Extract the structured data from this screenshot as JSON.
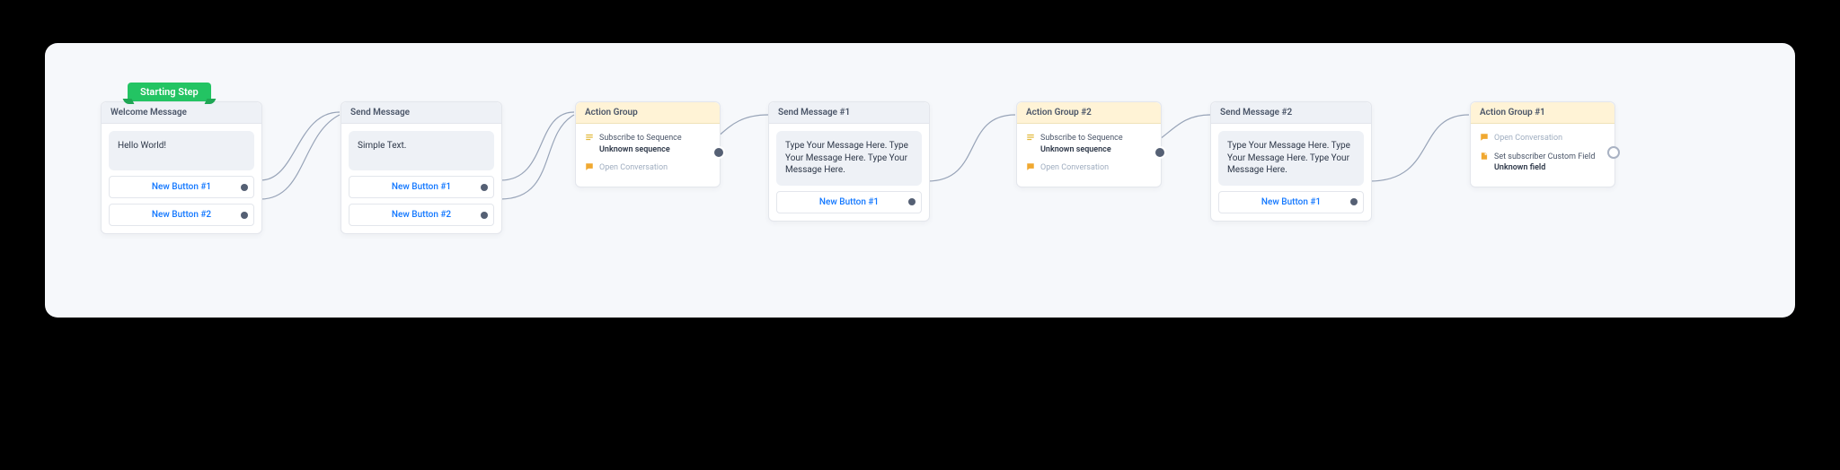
{
  "starting_step_label": "Starting Step",
  "nodes": {
    "welcome": {
      "title": "Welcome Message",
      "bubble": "Hello World!",
      "buttons": [
        "New Button #1",
        "New Button #2"
      ]
    },
    "send1": {
      "title": "Send Message",
      "bubble": "Simple Text.",
      "buttons": [
        "New Button #1",
        "New Button #2"
      ]
    },
    "ag1": {
      "title": "Action Group",
      "actions": [
        {
          "icon": "seq",
          "label": "Subscribe to Sequence",
          "sub": "Unknown sequence"
        },
        {
          "icon": "open",
          "label": "Open Conversation",
          "muted": true
        }
      ]
    },
    "sendmsg1": {
      "title": "Send Message #1",
      "bubble": "Type Your Message Here. Type Your Message Here. Type Your Message Here.",
      "buttons": [
        "New Button #1"
      ]
    },
    "ag2": {
      "title": "Action Group #2",
      "actions": [
        {
          "icon": "seq",
          "label": "Subscribe to Sequence",
          "sub": "Unknown sequence"
        },
        {
          "icon": "open",
          "label": "Open Conversation",
          "muted": true
        }
      ]
    },
    "sendmsg2": {
      "title": "Send Message #2",
      "bubble": "Type Your Message Here. Type Your Message Here. Type Your Message Here.",
      "buttons": [
        "New Button #1"
      ]
    },
    "ag_right": {
      "title": "Action Group #1",
      "actions": [
        {
          "icon": "open",
          "label": "Open Conversation",
          "muted": true
        },
        {
          "icon": "set",
          "label": "Set subscriber Custom Field",
          "sub": "Unknown field"
        }
      ]
    }
  }
}
